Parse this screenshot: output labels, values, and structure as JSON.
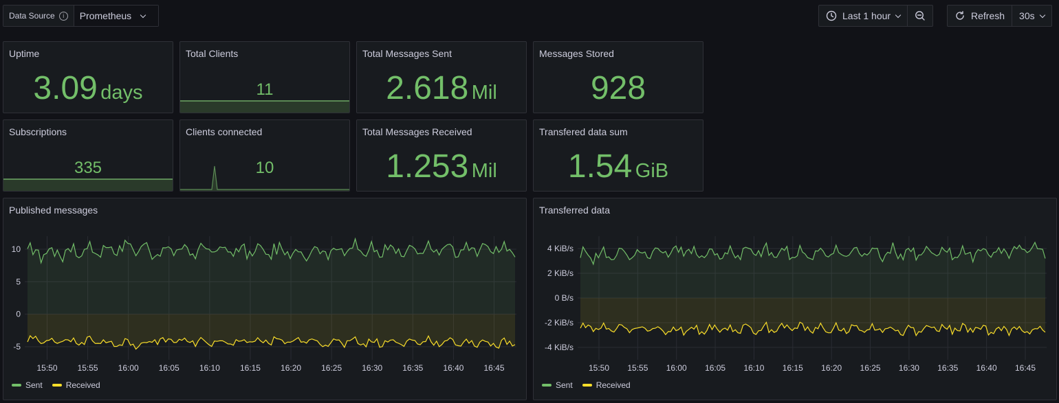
{
  "toolbar": {
    "datasource_label": "Data Source",
    "datasource_value": "Prometheus",
    "time_range": "Last 1 hour",
    "refresh_label": "Refresh",
    "refresh_interval": "30s"
  },
  "stats": {
    "uptime": {
      "title": "Uptime",
      "value": "3.09",
      "unit": "days"
    },
    "total_clients": {
      "title": "Total Clients",
      "value": "11"
    },
    "total_sent": {
      "title": "Total Messages Sent",
      "value": "2.618",
      "unit": "Mil"
    },
    "stored": {
      "title": "Messages Stored",
      "value": "928"
    },
    "subscriptions": {
      "title": "Subscriptions",
      "value": "335"
    },
    "clients_connected": {
      "title": "Clients connected",
      "value": "10"
    },
    "total_received": {
      "title": "Total Messages Received",
      "value": "1.253",
      "unit": "Mil"
    },
    "transferred_sum": {
      "title": "Transfered data sum",
      "value": "1.54",
      "unit": "GiB"
    }
  },
  "colors": {
    "sent": "#73bf69",
    "received": "#fade2a",
    "background": "#111217",
    "panel": "#181b1f"
  },
  "icons": {
    "info": "info-circle-icon",
    "clock": "clock-icon",
    "zoom_out": "zoom-out-icon",
    "refresh": "refresh-icon",
    "chevron": "chevron-down-icon"
  },
  "chart_data": [
    {
      "type": "line",
      "title": "Published messages",
      "x": [
        "15:50",
        "15:55",
        "16:00",
        "16:05",
        "16:10",
        "16:15",
        "16:20",
        "16:25",
        "16:30",
        "16:35",
        "16:40",
        "16:45"
      ],
      "ylim": [
        -7,
        12
      ],
      "yticks": [
        "10",
        "5",
        "0",
        "-5"
      ],
      "ytick_values": [
        10,
        5,
        0,
        -5
      ],
      "series": [
        {
          "name": "Sent",
          "values": [
            9.5,
            9.8,
            10.2,
            9.6,
            9.9,
            9.7,
            9.6,
            9.8,
            10.0,
            9.7,
            9.8,
            10.1
          ],
          "min": 7.5,
          "max": 11.6,
          "color": "#73bf69"
        },
        {
          "name": "Received",
          "values": [
            -4.0,
            -4.2,
            -4.5,
            -4.1,
            -4.3,
            -4.2,
            -4.1,
            -4.3,
            -4.4,
            -4.2,
            -4.3,
            -4.5
          ],
          "min": -5.5,
          "max": -3.3,
          "color": "#fade2a"
        }
      ],
      "legend": [
        "Sent",
        "Received"
      ]
    },
    {
      "type": "line",
      "title": "Transferred data",
      "x": [
        "15:50",
        "15:55",
        "16:00",
        "16:05",
        "16:10",
        "16:15",
        "16:20",
        "16:25",
        "16:30",
        "16:35",
        "16:40",
        "16:45"
      ],
      "ylim": [
        -5,
        5
      ],
      "yunit": "KiB/s",
      "yticks": [
        "4 KiB/s",
        "2 KiB/s",
        "0 B/s",
        "-2 KiB/s",
        "-4 KiB/s"
      ],
      "ytick_values": [
        4,
        2,
        0,
        -2,
        -4
      ],
      "series": [
        {
          "name": "Sent",
          "values": [
            3.5,
            3.6,
            3.8,
            3.6,
            3.7,
            3.6,
            3.6,
            3.7,
            3.7,
            3.6,
            3.7,
            3.9
          ],
          "min": 2.6,
          "max": 4.5,
          "color": "#73bf69"
        },
        {
          "name": "Received",
          "values": [
            -2.4,
            -2.5,
            -2.6,
            -2.5,
            -2.5,
            -2.4,
            -2.5,
            -2.5,
            -2.6,
            -2.5,
            -2.5,
            -2.6
          ],
          "min": -3.2,
          "max": -1.9,
          "color": "#fade2a"
        }
      ],
      "legend": [
        "Sent",
        "Received"
      ]
    }
  ]
}
